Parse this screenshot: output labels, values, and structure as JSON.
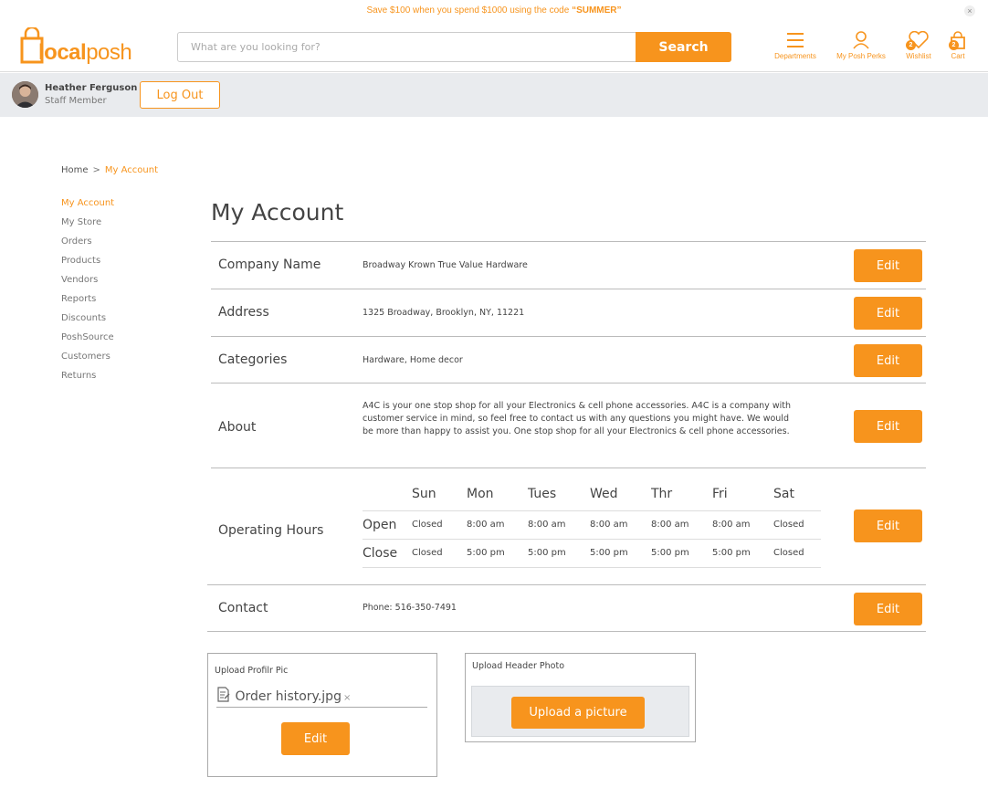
{
  "promo": {
    "text": "Save $100 when you spend $1000 using the code ",
    "code": "“SUMMER”",
    "close": "×"
  },
  "brand": {
    "name_light": "local",
    "name_bold": "posh",
    "color": "#f7941d"
  },
  "search": {
    "placeholder": "What are you looking for?",
    "button": "Search"
  },
  "header_icons": [
    {
      "label": "Departments",
      "icon": "menu-icon"
    },
    {
      "label": "My Posh Perks",
      "icon": "user-icon"
    },
    {
      "label": "Wishlist",
      "icon": "heart-icon",
      "badge": "2"
    },
    {
      "label": "Cart",
      "icon": "bag-icon",
      "badge": "2"
    }
  ],
  "user": {
    "name": "Heather Ferguson",
    "role": "Staff Member",
    "logout": "Log Out"
  },
  "breadcrumb": {
    "home": "Home",
    "sep": ">",
    "current": "My Account"
  },
  "sidenav": [
    "My Account",
    "My Store",
    "Orders",
    "Products",
    "Vendors",
    "Reports",
    "Discounts",
    "PoshSource",
    "Customers",
    "Returns"
  ],
  "page_title": "My Account",
  "edit_label": "Edit",
  "rows": {
    "company": {
      "label": "Company Name",
      "value": "Broadway Krown True Value Hardware"
    },
    "address": {
      "label": "Address",
      "value": "1325 Broadway, Brooklyn, NY, 11221"
    },
    "categories": {
      "label": "Categories",
      "value": "Hardware, Home decor"
    },
    "about": {
      "label": "About",
      "value": "A4C is your one stop shop for all your Electronics & cell phone accessories. A4C is a company with customer service in mind, so feel free to contact us with any questions you might have. We would be more than happy to assist you. One stop shop for all your Electronics & cell phone accessories."
    },
    "hours": {
      "label": "Operating Hours",
      "days": [
        "Sun",
        "Mon",
        "Tues",
        "Wed",
        "Thr",
        "Fri",
        "Sat"
      ],
      "open_label": "Open",
      "close_label": "Close",
      "open": [
        "Closed",
        "8:00 am",
        "8:00 am",
        "8:00 am",
        "8:00 am",
        "8:00 am",
        "Closed"
      ],
      "close": [
        "Closed",
        "5:00 pm",
        "5:00 pm",
        "5:00 pm",
        "5:00 pm",
        "5:00 pm",
        "Closed"
      ]
    },
    "contact": {
      "label": "Contact",
      "value": "Phone: 516-350-7491"
    }
  },
  "upload_profile": {
    "title": "Upload Profilr Pic",
    "file": "Order history.jpg",
    "remove": "×",
    "button": "Edit"
  },
  "upload_header": {
    "title": "Upload Header Photo",
    "button": "Upload a picture"
  }
}
